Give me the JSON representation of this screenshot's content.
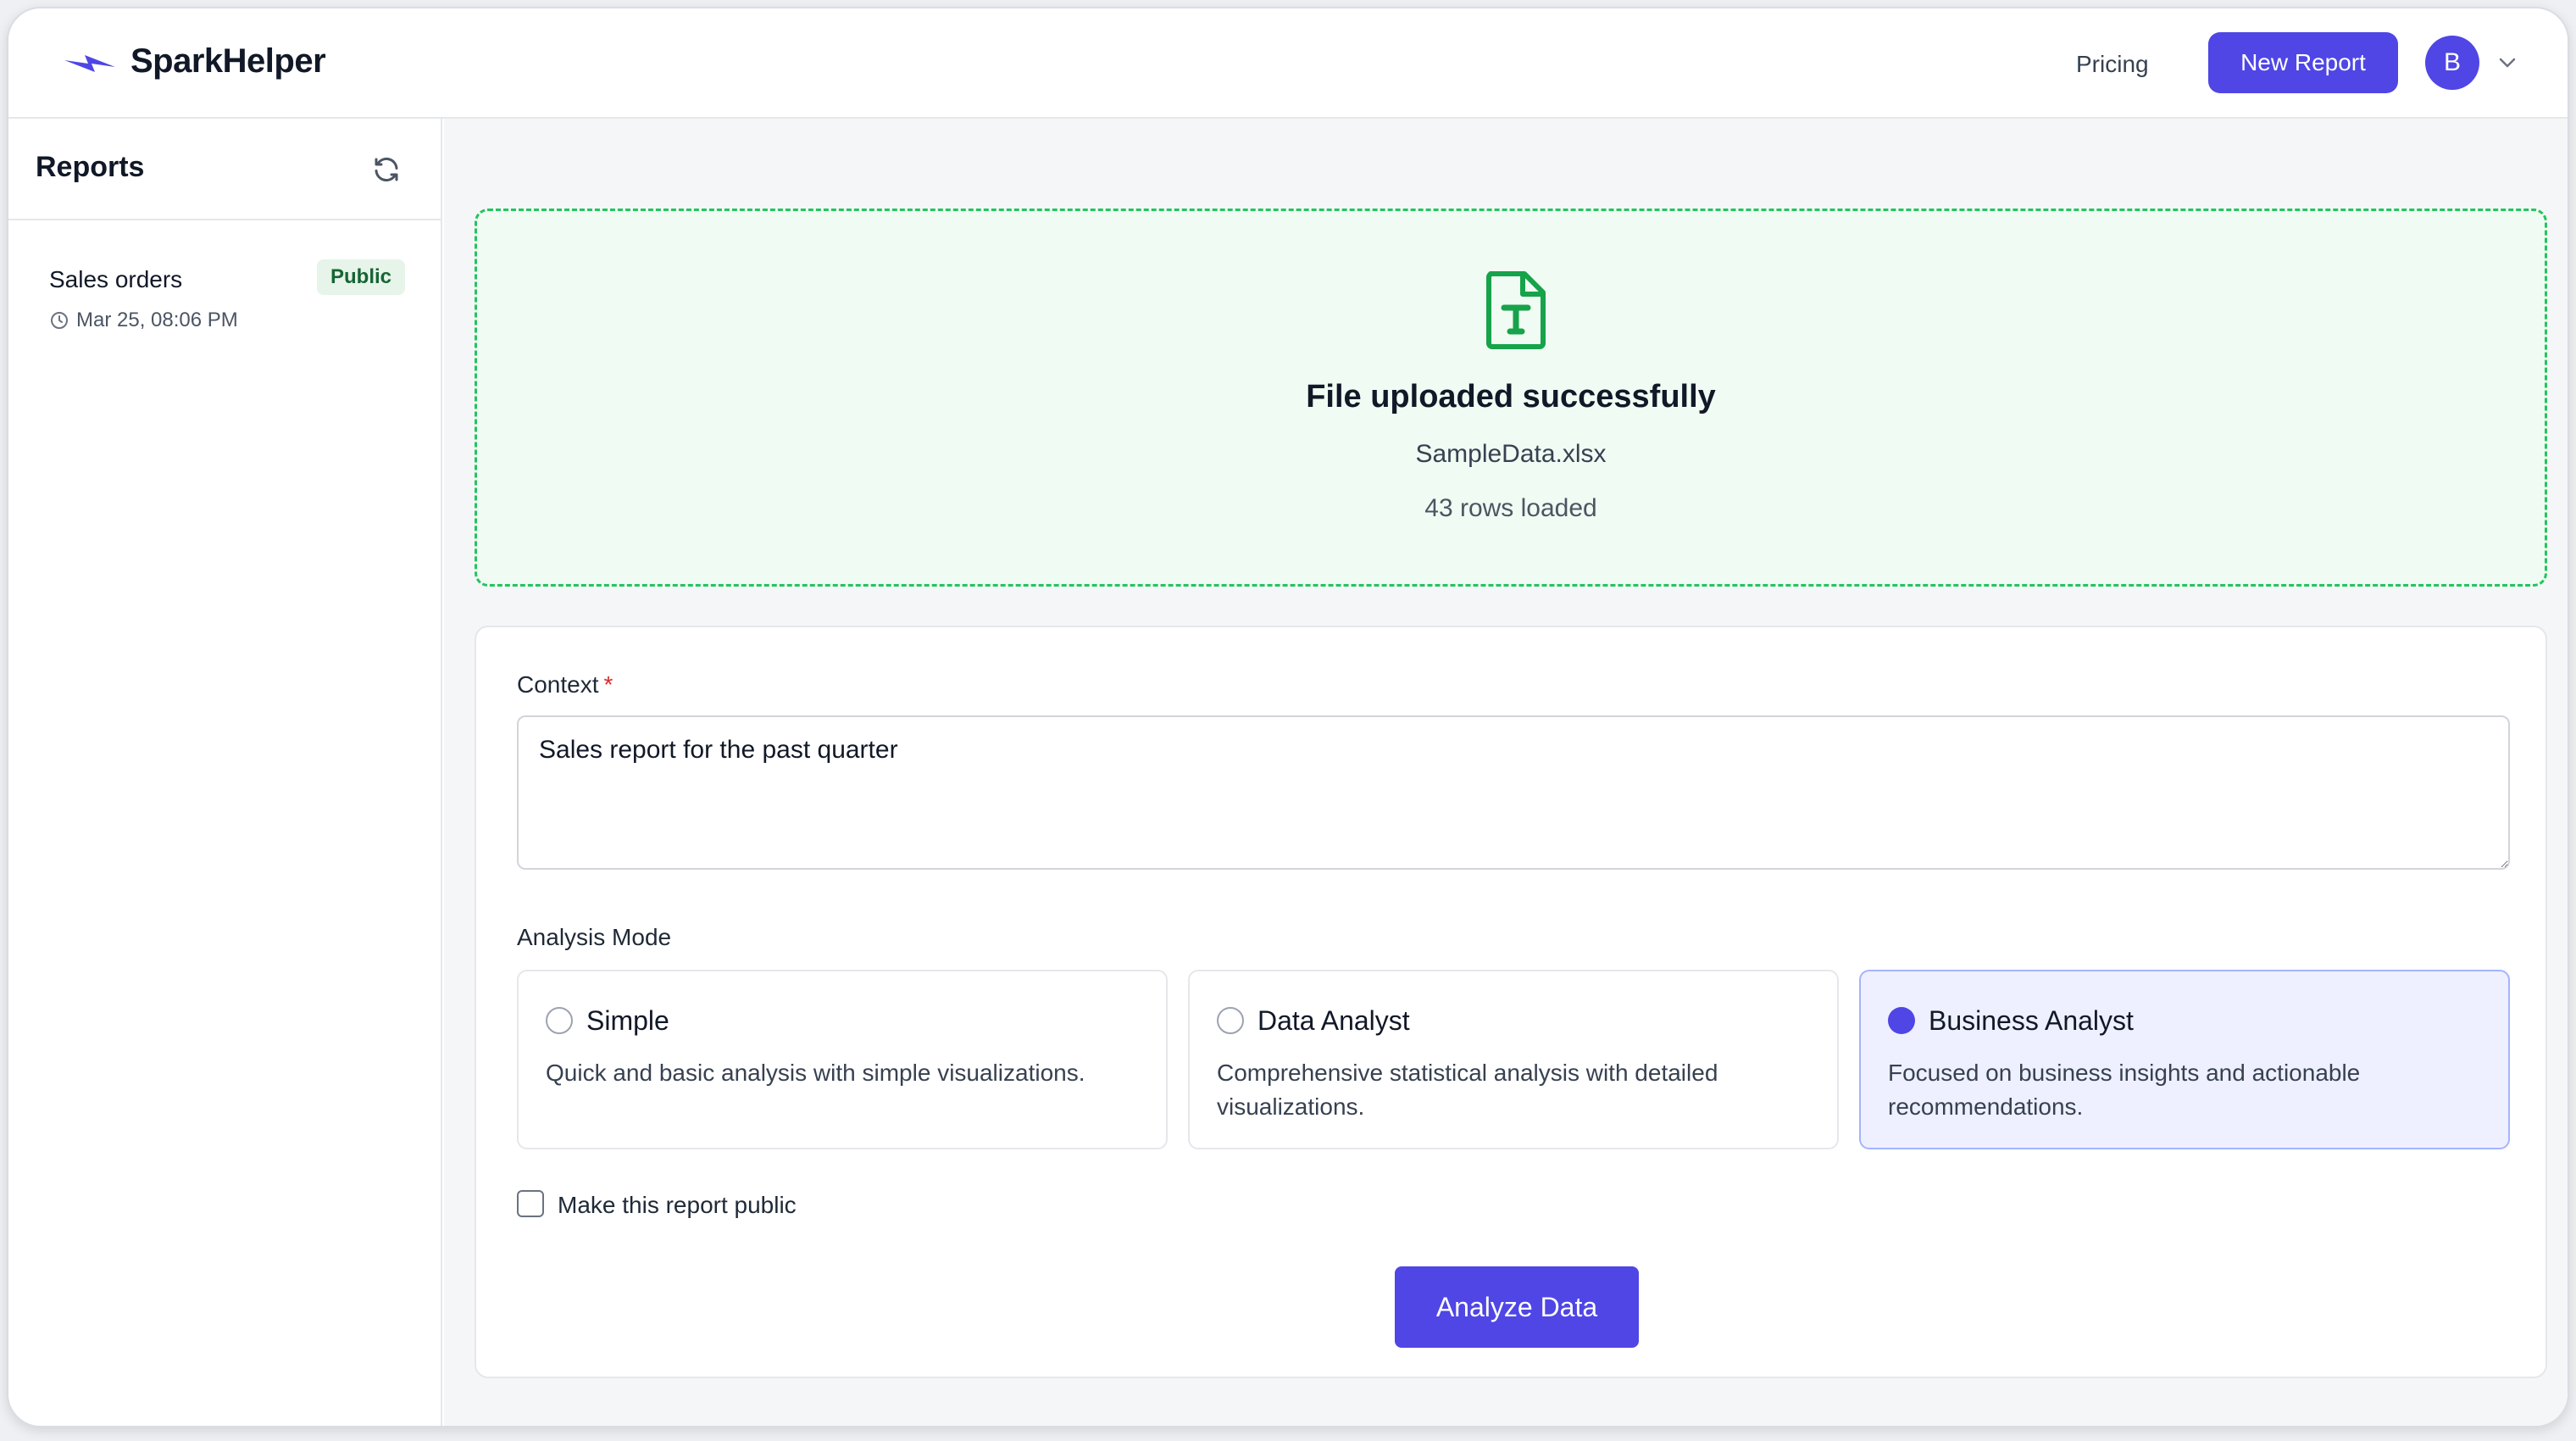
{
  "app": {
    "name": "SparkHelper",
    "logo_icon": "lightning-bolt-icon",
    "accent_color": "#4f46e5"
  },
  "header": {
    "pricing_label": "Pricing",
    "new_report_label": "New Report",
    "avatar_initial": "B"
  },
  "sidebar": {
    "title": "Reports",
    "reports": [
      {
        "name": "Sales orders",
        "badge": "Public",
        "timestamp": "Mar 25, 08:06 PM"
      }
    ]
  },
  "upload": {
    "title": "File uploaded successfully",
    "filename": "SampleData.xlsx",
    "rows_text": "43 rows loaded",
    "status_color": "#22c55e"
  },
  "form": {
    "context_label": "Context",
    "required_mark": "*",
    "context_value": "Sales report for the past quarter",
    "analysis_mode_label": "Analysis Mode",
    "modes": [
      {
        "title": "Simple",
        "description": "Quick and basic analysis with simple visualizations.",
        "selected": false
      },
      {
        "title": "Data Analyst",
        "description": "Comprehensive statistical analysis with detailed visualizations.",
        "selected": false
      },
      {
        "title": "Business Analyst",
        "description": "Focused on business insights and actionable recommendations.",
        "selected": true
      }
    ],
    "public_checkbox_label": "Make this report public",
    "public_checked": false,
    "analyze_label": "Analyze Data"
  }
}
